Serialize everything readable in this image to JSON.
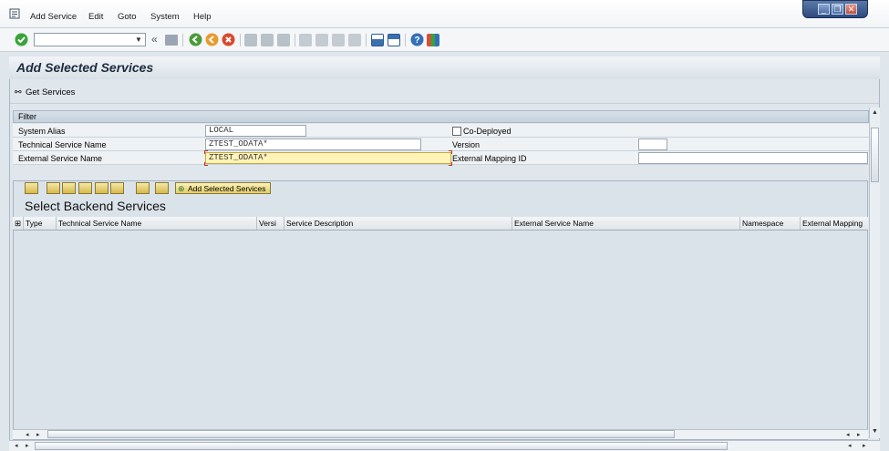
{
  "menu": {
    "items": [
      "Add Service",
      "Edit",
      "Goto",
      "System",
      "Help"
    ]
  },
  "window": {
    "minimize": "_",
    "restore": "❐",
    "close": "✕"
  },
  "toolbar": {
    "command_value": "",
    "back_label": "«"
  },
  "page": {
    "title": "Add Selected Services",
    "get_services_label": "Get Services"
  },
  "filter": {
    "header": "Filter",
    "system_alias_label": "System Alias",
    "system_alias_value": "LOCAL",
    "tech_service_label": "Technical Service Name",
    "tech_service_value": "ZTEST_ODATA*",
    "ext_service_label": "External Service Name",
    "ext_service_value": "ZTEST_ODATA*",
    "co_deployed_label": "Co-Deployed",
    "version_label": "Version",
    "version_value": "",
    "ext_mapping_label": "External Mapping ID",
    "ext_mapping_value": ""
  },
  "alv": {
    "add_selected_label": "Add Selected Services",
    "title": "Select Backend Services",
    "columns": [
      "Type",
      "Technical Service Name",
      "Versi",
      "Service Description",
      "External Service Name",
      "Namespace",
      "External Mapping"
    ]
  },
  "colors": {
    "accent": "#2d4a7c",
    "highlight_field": "#fff3b8",
    "background": "#dfe6ec"
  }
}
